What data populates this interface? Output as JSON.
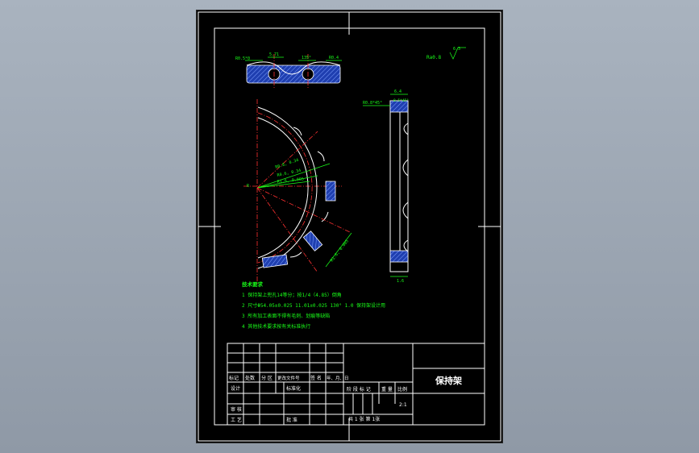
{
  "colors": {
    "background": "#000000",
    "dimension": "#19ff19",
    "outline": "#ffffff",
    "centerline": "#ff3030",
    "section": "#2a6bff"
  },
  "dims": {
    "top_left": "R0.5*0",
    "top_mid": "5.71",
    "top_angle": "135°",
    "top_right": "R0.4",
    "roughness": "Ra0.8",
    "pocket_1": "R0.8, 0.34",
    "pocket_2": "R0.6, 0.34",
    "pocket_3": "R1.6, 0.005",
    "center_mark": "R",
    "radius_big": "R1.6, 0.005",
    "side_top": "R0.8*45°",
    "side_width": "6.4",
    "side_small": "0.5*45°",
    "side_bottom": "1.6",
    "roughness_symbol": "6.3"
  },
  "notes": {
    "heading": "技术要求",
    "lines": [
      "1  保持架上兜孔14等分；按1/4（4.85）倒角",
      "2  尺寸Φ54.05±0.025  11.01±0.025  130°  1.0  保持架设计用",
      "3  所有加工表面不得有毛刺、划痕等缺陷",
      "4  其他技术要求按有关标准执行"
    ]
  },
  "title_block": {
    "part_name": "保持架",
    "rev_headers": [
      "标记",
      "处数",
      "分 区",
      "更改文件号",
      "签 名",
      "年、月、日"
    ],
    "design": "设计",
    "standardize": "标准化",
    "review": "审 核",
    "process": "工 艺",
    "approve": "批 准",
    "stage": "阶 段 标 记",
    "weight": "重 量",
    "scale_label": "比例",
    "scale": "2:1",
    "sheets": "共 1  张   第   1张"
  }
}
